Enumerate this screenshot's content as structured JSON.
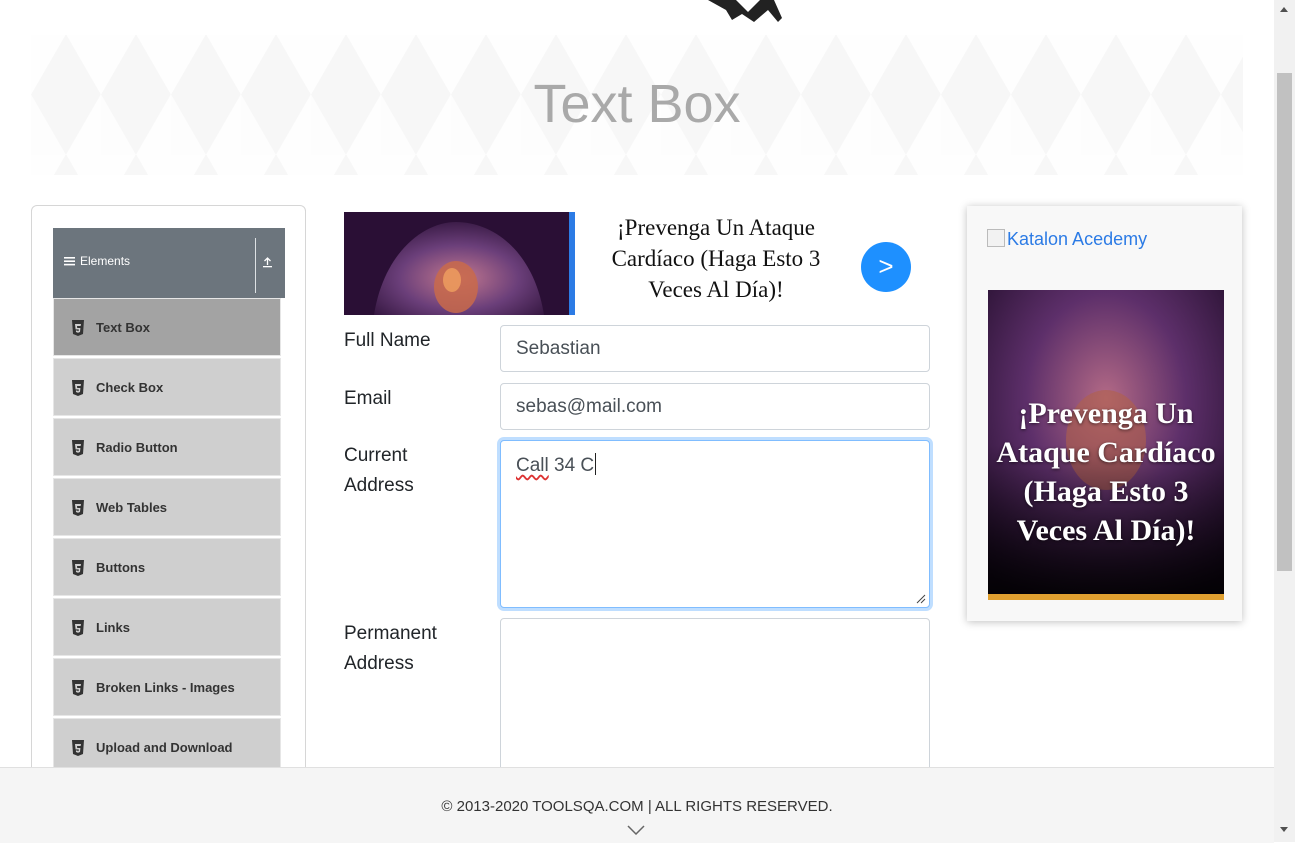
{
  "header": {
    "logo_name": "logo-icon"
  },
  "banner": {
    "title": "Text Box"
  },
  "sidebar": {
    "group_label": "Elements",
    "items": [
      {
        "label": "Text Box",
        "active": true
      },
      {
        "label": "Check Box"
      },
      {
        "label": "Radio Button"
      },
      {
        "label": "Web Tables"
      },
      {
        "label": "Buttons"
      },
      {
        "label": "Links"
      },
      {
        "label": "Broken Links - Images"
      },
      {
        "label": "Upload and Download"
      }
    ]
  },
  "ad_top": {
    "text": "¡Prevenga Un Ataque Cardíaco (Haga Esto 3 Veces Al Día)!",
    "arrow": ">"
  },
  "form": {
    "full_name_label": "Full Name",
    "full_name_value": "Sebastian",
    "email_label": "Email",
    "email_value": "sebas@mail.com",
    "current_address_label_1": "Current",
    "current_address_label_2": "Address",
    "current_address_word1": "Call",
    "current_address_rest": " 34 C",
    "permanent_address_label_1": "Permanent",
    "permanent_address_label_2": "Address",
    "permanent_address_value": ""
  },
  "right_panel": {
    "link_text": "Katalon Acedemy",
    "ad_text": "¡Prevenga Un Ataque Cardíaco (Haga Esto 3 Veces Al Día)!"
  },
  "footer": {
    "text": "© 2013-2020 TOOLSQA.COM | ALL RIGHTS RESERVED."
  },
  "colors": {
    "sidebar_header": "#6c757d",
    "sidebar_item": "#cfcfcf",
    "active_item": "#a3a3a3",
    "accent": "#1e90ff"
  }
}
